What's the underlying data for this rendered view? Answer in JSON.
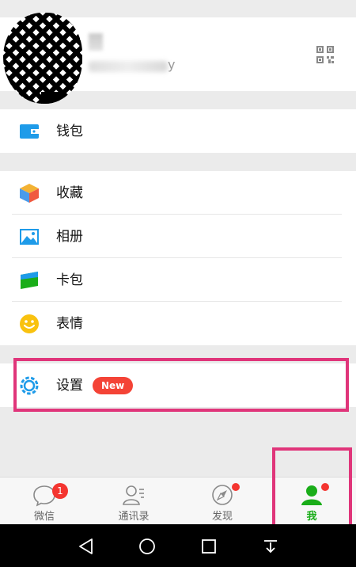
{
  "profile": {
    "id_tail": "y"
  },
  "menu": {
    "wallet": "钱包",
    "favorites": "收藏",
    "album": "相册",
    "cards": "卡包",
    "stickers": "表情",
    "settings": "设置",
    "settings_badge": "New"
  },
  "tabs": [
    {
      "label": "微信",
      "badge": "1",
      "icon": "chat-bubble-icon"
    },
    {
      "label": "通讯录",
      "icon": "contacts-icon"
    },
    {
      "label": "发现",
      "icon": "compass-icon"
    },
    {
      "label": "我",
      "icon": "person-icon",
      "active": true
    }
  ],
  "colors": {
    "accent_green": "#1aad19",
    "badge_red": "#f43530",
    "highlight": "#e0357a"
  }
}
